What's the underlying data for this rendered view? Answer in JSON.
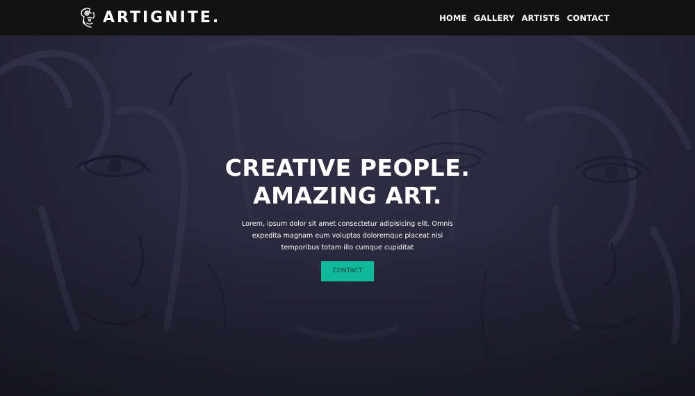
{
  "navbar": {
    "brand": {
      "name": "ARTIGNITE.",
      "icon": "face-illustration-logo-icon"
    },
    "links": [
      {
        "label": "HOME"
      },
      {
        "label": "GALLERY"
      },
      {
        "label": "ARTISTS"
      },
      {
        "label": "CONTACT"
      }
    ]
  },
  "hero": {
    "title_line1": "CREATIVE PEOPLE.",
    "title_line2": "AMAZING ART.",
    "description": "Lorem, ipsum dolor sit amet consectetur adipisicing elit. Omnis expedita magnam eum voluptas doloremque placeat nisi temporibus totam illo cumque cupiditat",
    "button_label": "CONTACT",
    "background": "painted-faces-artwork"
  },
  "colors": {
    "navbar_bg": "#121212",
    "hero_bg": "#2b2a3f",
    "accent": "#10b89c",
    "text": "#ffffff"
  }
}
